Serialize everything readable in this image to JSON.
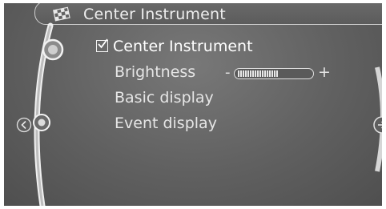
{
  "header": {
    "title": "Center Instrument",
    "icon": "checkered-flag-icon"
  },
  "menu": {
    "items": [
      {
        "label": "Center Instrument",
        "selected": true,
        "checked": true
      },
      {
        "label": "Brightness"
      },
      {
        "label": "Basic display"
      },
      {
        "label": "Event display"
      }
    ]
  },
  "brightness": {
    "minus": "-",
    "plus": "+",
    "level": 0.55
  },
  "colors": {
    "screen": "#606060",
    "text": "#e6e6e6",
    "accent": "#ffffff"
  }
}
